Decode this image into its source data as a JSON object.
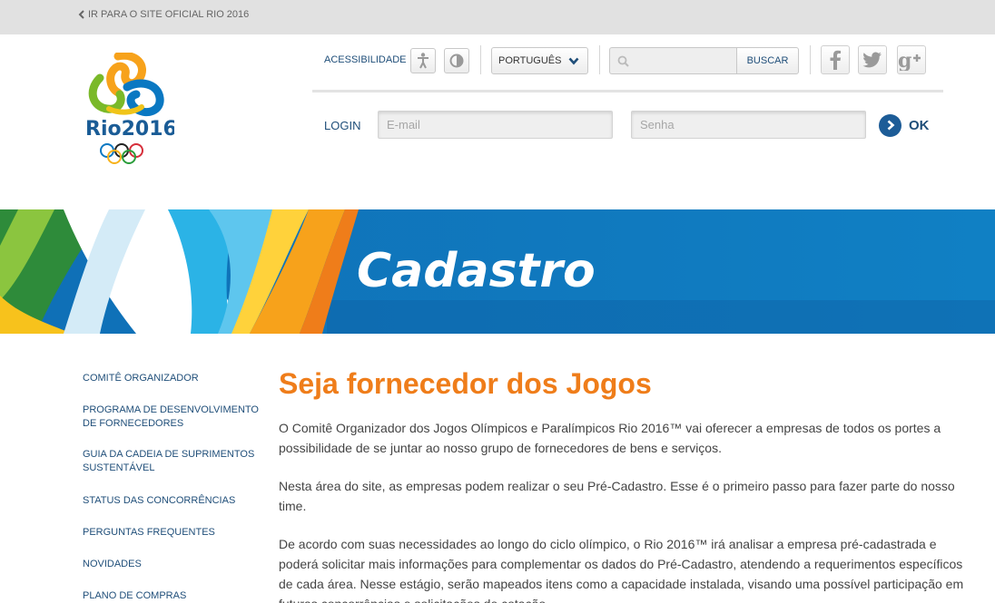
{
  "topbar": {
    "link_label": "IR PARA O SITE OFICIAL RIO 2016"
  },
  "logo": {
    "text": "Rio2016"
  },
  "utility": {
    "accessibility_label": "ACESSIBILIDADE",
    "language_selected": "PORTUGUÊS",
    "search_placeholder": "",
    "search_button": "BUSCAR"
  },
  "login": {
    "label": "LOGIN",
    "email_placeholder": "E-mail",
    "password_placeholder": "Senha",
    "submit_label": "OK"
  },
  "banner": {
    "title": "Cadastro"
  },
  "sidebar": {
    "items": [
      {
        "label": "COMITÊ ORGANIZADOR"
      },
      {
        "label": "PROGRAMA DE DESENVOLVIMENTO DE FORNECEDORES"
      },
      {
        "label": "GUIA DA CADEIA DE SUPRIMENTOS SUSTENTÁVEL"
      },
      {
        "label": "STATUS DAS CONCORRÊNCIAS"
      },
      {
        "label": "PERGUNTAS FREQUENTES"
      },
      {
        "label": "NOVIDADES"
      },
      {
        "label": "PLANO DE COMPRAS"
      }
    ]
  },
  "main": {
    "heading": "Seja fornecedor dos Jogos",
    "paragraphs": [
      "O Comitê Organizador dos Jogos Olímpicos e Paralímpicos Rio 2016™ vai oferecer a empresas de todos os portes a possibilidade de se juntar ao nosso grupo de fornecedores de bens e serviços.",
      "Nesta área do site, as empresas podem realizar o seu Pré-Cadastro. Esse é o primeiro passo para fazer parte do nosso time.",
      "De acordo com suas necessidades ao longo do ciclo olímpico, o Rio 2016™ irá analisar a empresa pré-cadastrada e poderá solicitar mais informações para complementar os dados do Pré-Cadastro, atendendo a requerimentos específicos de cada área. Nesse estágio, serão mapeados itens como a capacidade instalada, visando uma possível participação em futuras concorrências e solicitações de cotação."
    ]
  },
  "colors": {
    "accent_orange": "#ef7d1a",
    "link_blue": "#1f4e79",
    "banner_blue": "#0f6fb6"
  }
}
